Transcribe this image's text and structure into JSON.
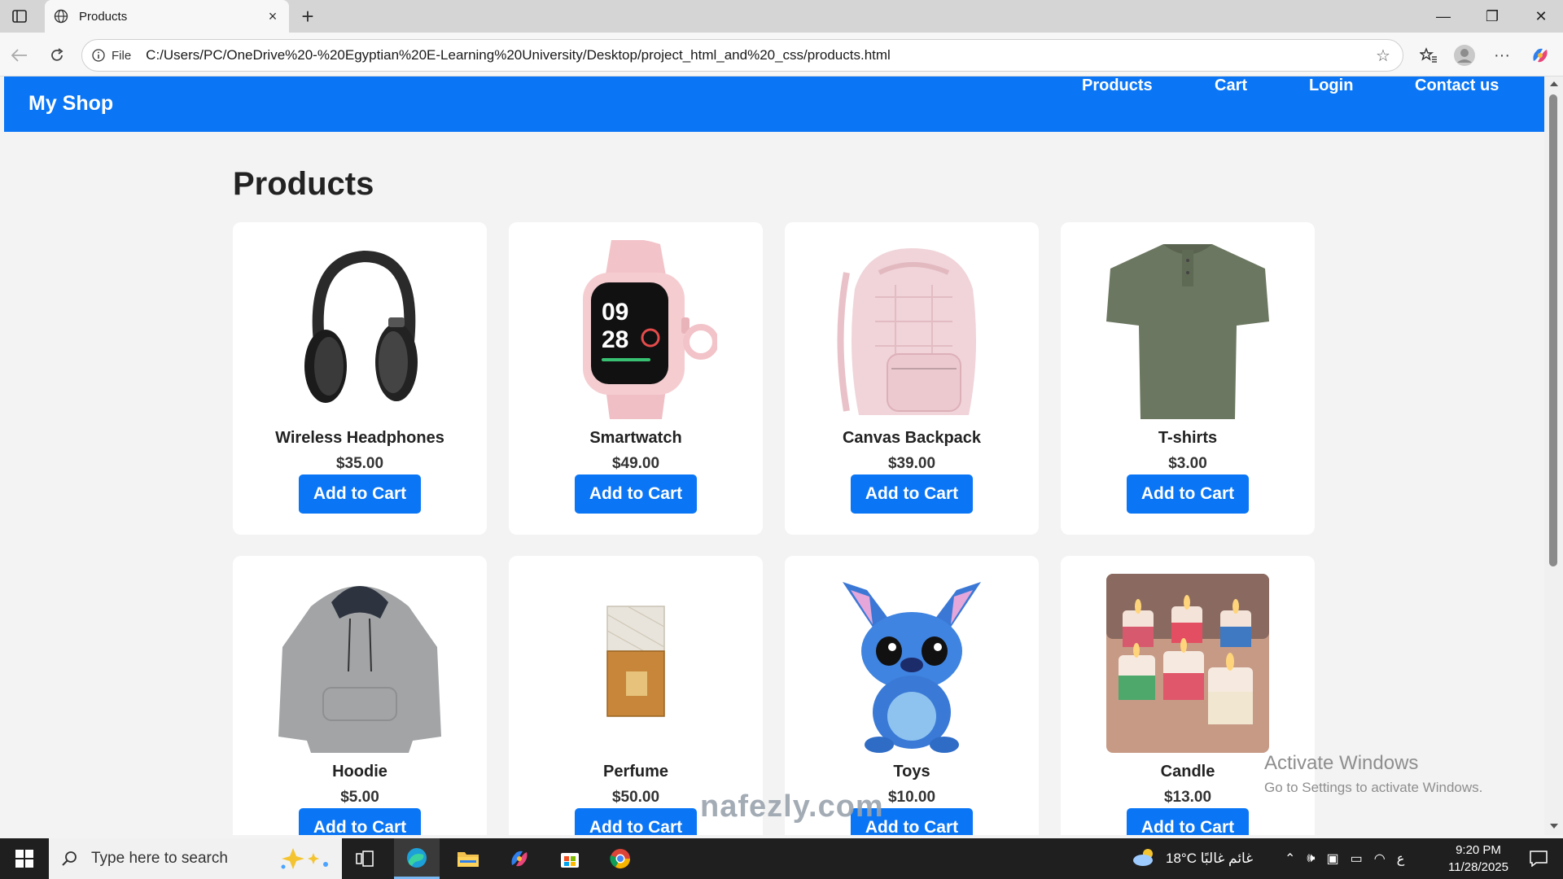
{
  "browser": {
    "tab_title": "Products",
    "new_tab": "+",
    "close_tab": "×",
    "window_min": "—",
    "window_max": "❐",
    "window_close": "✕",
    "address_prefix": "File",
    "url": "C:/Users/PC/OneDrive%20-%20Egyptian%20E-Learning%20University/Desktop/project_html_and%20_css/products.html"
  },
  "site": {
    "brand": "My Shop",
    "nav": [
      "Products",
      "Cart",
      "Login",
      "Contact us"
    ],
    "page_title": "Products",
    "accent_color": "#0a76f5",
    "products": [
      {
        "name": "Wireless Headphones",
        "price": "$35.00",
        "button": "Add to Cart",
        "icon": "headphones-image"
      },
      {
        "name": "Smartwatch",
        "price": "$49.00",
        "button": "Add to Cart",
        "icon": "smartwatch-image"
      },
      {
        "name": "Canvas Backpack",
        "price": "$39.00",
        "button": "Add to Cart",
        "icon": "backpack-image"
      },
      {
        "name": "T-shirts",
        "price": "$3.00",
        "button": "Add to Cart",
        "icon": "tshirt-image"
      },
      {
        "name": "Hoodie",
        "price": "$5.00",
        "button": "Add to Cart",
        "icon": "hoodie-image"
      },
      {
        "name": "Perfume",
        "price": "$50.00",
        "button": "Add to Cart",
        "icon": "perfume-image"
      },
      {
        "name": "Toys",
        "price": "$10.00",
        "button": "Add to Cart",
        "icon": "toy-image"
      },
      {
        "name": "Candle",
        "price": "$13.00",
        "button": "Add to Cart",
        "icon": "candle-image"
      }
    ]
  },
  "overlay": {
    "activate_title": "Activate Windows",
    "activate_sub": "Go to Settings to activate Windows.",
    "watermark": "nafezly.com"
  },
  "taskbar": {
    "search_placeholder": "Type here to search",
    "weather": "18°C  غائم غالبًا",
    "time": "9:20 PM",
    "date": "11/28/2025",
    "lang": "ع"
  }
}
